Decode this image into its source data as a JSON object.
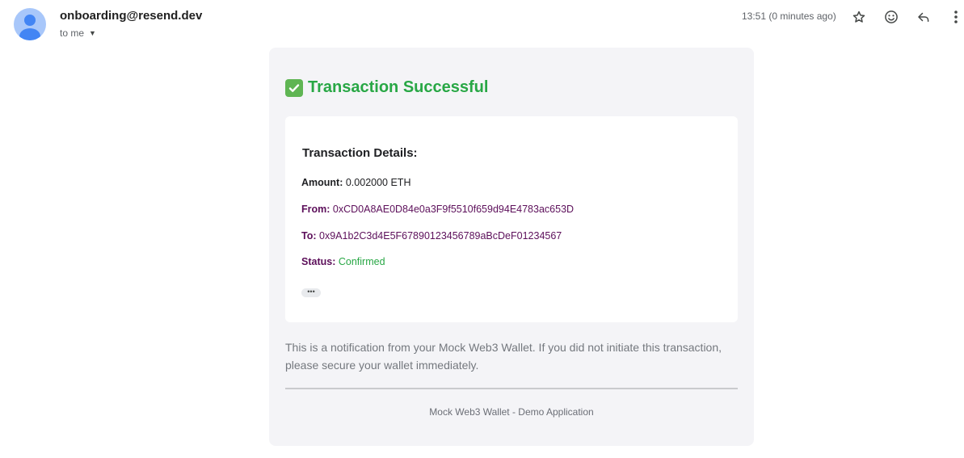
{
  "header": {
    "sender": "onboarding@resend.dev",
    "recipient": "to me",
    "timestamp": "13:51 (0 minutes ago)",
    "icons": [
      "avatar-icon",
      "star-icon",
      "emoji-icon",
      "reply-icon",
      "more-vert-icon"
    ]
  },
  "email": {
    "title": "Transaction Successful",
    "title_icon": "check-mark-button-icon",
    "details_heading": "Transaction Details:",
    "amount_label": "Amount:",
    "amount_value": "0.002000 ETH",
    "from_label": "From:",
    "from_value": "0xCD0A8AE0D84e0a3F9f5510f659d94E4783ac653D",
    "to_label": "To:",
    "to_value": "0x9A1b2C3d4E5F67890123456789aBcDeF01234567",
    "status_label": "Status:",
    "status_value": "Confirmed",
    "ellipsis": "•••",
    "note": "This is a notification from your Mock Web3 Wallet. If you did not initiate this transaction, please secure your wallet immediately.",
    "footer": "Mock Web3 Wallet - Demo Application"
  },
  "colors": {
    "success": "#28a745",
    "label_purple": "#5c0f5a",
    "card_bg": "#f4f4f7",
    "avatar_bg": "#a8c7fa",
    "avatar_fg": "#4285f4"
  }
}
